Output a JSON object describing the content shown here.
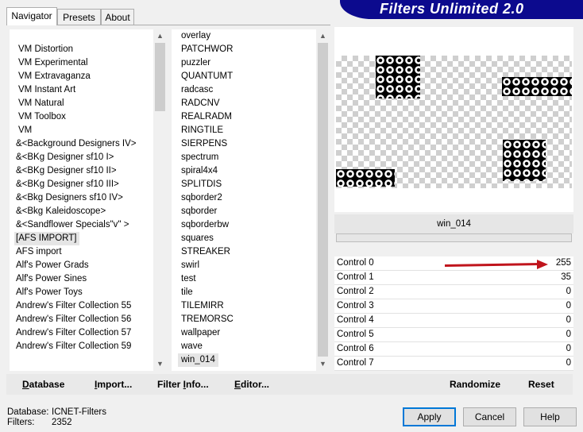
{
  "banner": {
    "title": "Filters Unlimited 2.0"
  },
  "tabs": [
    {
      "label": "Navigator",
      "active": true
    },
    {
      "label": "Presets",
      "active": false
    },
    {
      "label": "About",
      "active": false
    }
  ],
  "categories": [
    "VM Distortion",
    "VM Experimental",
    "VM Extravaganza",
    "VM Instant Art",
    "VM Natural",
    "VM Toolbox",
    "VM",
    "&<Background Designers IV>",
    "&<BKg Designer sf10 I>",
    "&<BKg Designer sf10 II>",
    "&<BKg Designer sf10 III>",
    "&<Bkg Designers sf10 IV>",
    "&<Bkg Kaleidoscope>",
    "&<Sandflower Specials\"v\" >",
    "[AFS IMPORT]",
    "AFS import",
    "Alf's Power Grads",
    "Alf's Power Sines",
    "Alf's Power Toys",
    "Andrew's Filter Collection 55",
    "Andrew's Filter Collection 56",
    "Andrew's Filter Collection 57",
    "Andrew's Filter Collection 59"
  ],
  "filters": [
    "overlay",
    "PATCHWOR",
    "puzzler",
    "QUANTUMT",
    "radcasc",
    "RADCNV",
    "REALRADM",
    "RINGTILE",
    "SIERPENS",
    "spectrum",
    "spiral4x4",
    "SPLITDIS",
    "sqborder2",
    "sqborder",
    "sqborderbw",
    "squares",
    "STREAKER",
    "swirl",
    "test",
    "tile",
    "TILEMIRR",
    "TREMORSC",
    "wallpaper",
    "wave",
    "win_014"
  ],
  "selected_category": "[AFS IMPORT]",
  "selected_filter": "win_014",
  "preview": {
    "filter_name": "win_014"
  },
  "controls": [
    {
      "label": "Control 0",
      "value": "255"
    },
    {
      "label": "Control 1",
      "value": "35"
    },
    {
      "label": "Control 2",
      "value": "0"
    },
    {
      "label": "Control 3",
      "value": "0"
    },
    {
      "label": "Control 4",
      "value": "0"
    },
    {
      "label": "Control 5",
      "value": "0"
    },
    {
      "label": "Control 6",
      "value": "0"
    },
    {
      "label": "Control 7",
      "value": "0"
    }
  ],
  "toolbar": {
    "database": {
      "u": "D",
      "rest": "atabase"
    },
    "import": {
      "u": "I",
      "rest": "mport..."
    },
    "filter_info": {
      "pre": "Filter ",
      "u": "I",
      "rest": "nfo..."
    },
    "editor": {
      "u": "E",
      "rest": "ditor..."
    },
    "randomize": "Randomize",
    "reset": "Reset"
  },
  "status": {
    "database_label": "Database:",
    "database_value": "ICNET-Filters",
    "filters_label": "Filters:",
    "filters_value": "2352"
  },
  "buttons": {
    "apply": "Apply",
    "cancel": "Cancel",
    "help": "Help"
  },
  "colors": {
    "banner": "#0c0a8e",
    "arrow": "#c0141c",
    "focus": "#0078d7"
  }
}
